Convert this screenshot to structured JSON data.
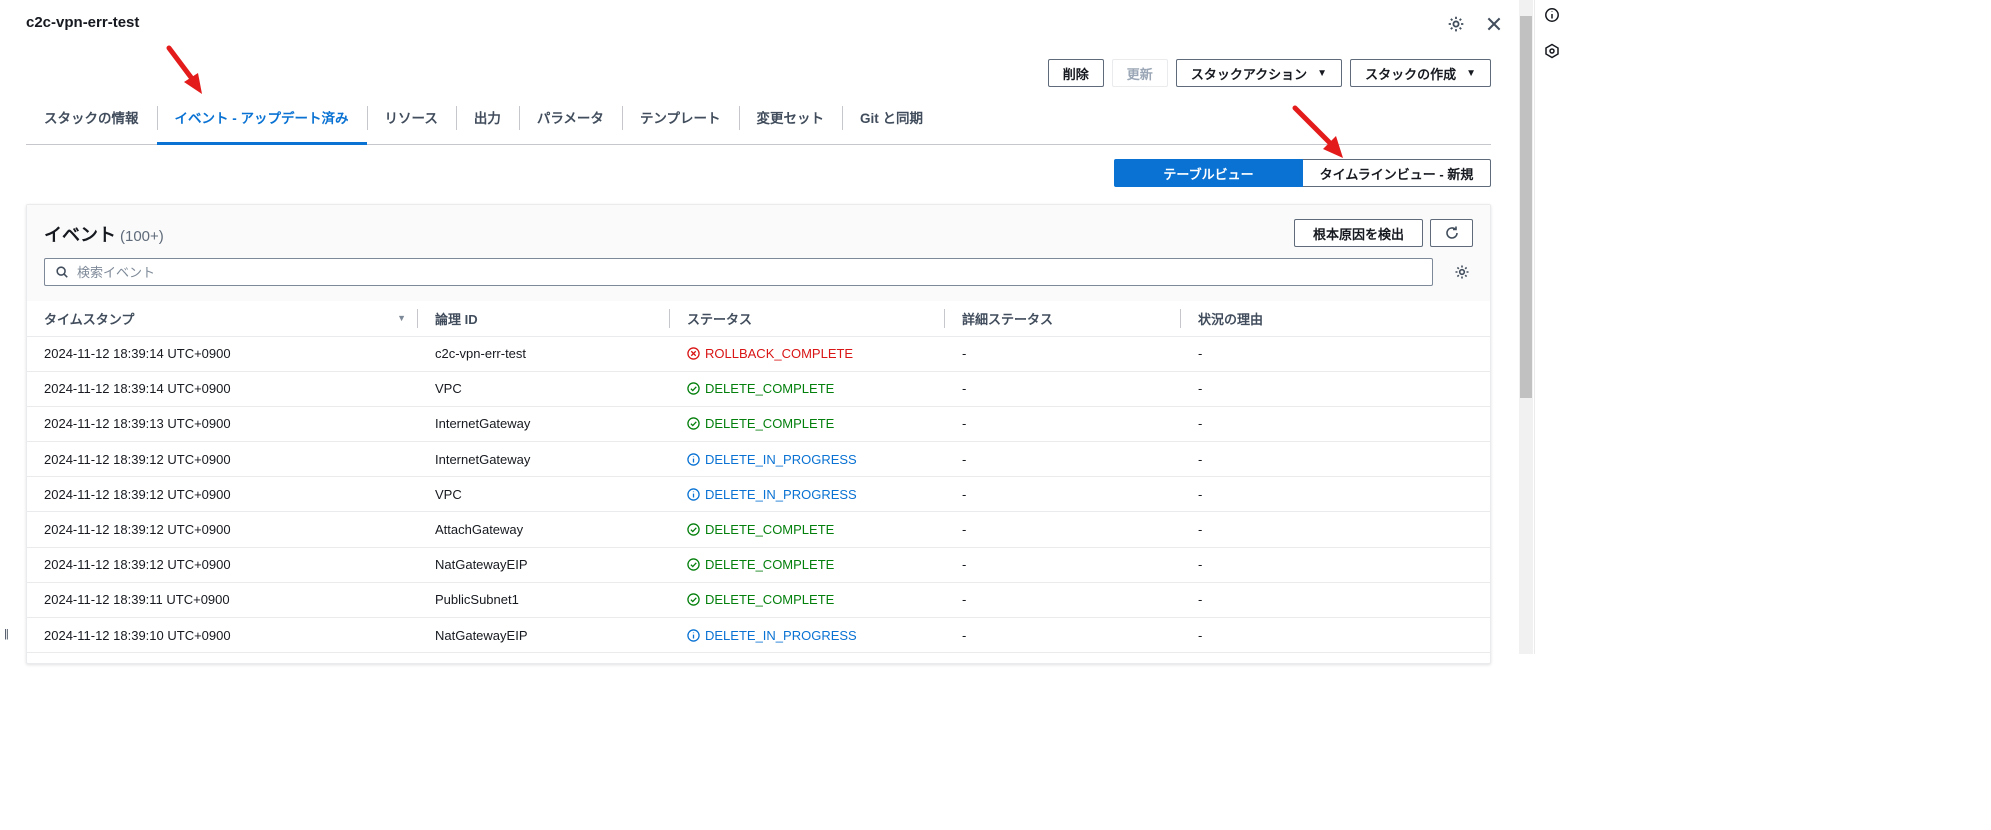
{
  "header": {
    "title": "c2c-vpn-err-test"
  },
  "actions": {
    "delete_label": "削除",
    "update_label": "更新",
    "stack_actions_label": "スタックアクション",
    "create_stack_label": "スタックの作成"
  },
  "tabs": [
    {
      "label": "スタックの情報"
    },
    {
      "label": "イベント - アップデート済み"
    },
    {
      "label": "リソース"
    },
    {
      "label": "出力"
    },
    {
      "label": "パラメータ"
    },
    {
      "label": "テンプレート"
    },
    {
      "label": "変更セット"
    },
    {
      "label": "Git と同期"
    }
  ],
  "active_tab": "イベント - アップデート済み",
  "view_toggle": {
    "table_view": "テーブルビュー",
    "timeline_view": "タイムラインビュー - 新規"
  },
  "events": {
    "title": "イベント",
    "count": "(100+)",
    "root_cause_label": "根本原因を検出",
    "search_placeholder": "検索イベント",
    "columns": [
      "タイムスタンプ",
      "論理 ID",
      "ステータス",
      "詳細ステータス",
      "状況の理由"
    ],
    "rows": [
      {
        "timestamp": "2024-11-12 18:39:14 UTC+0900",
        "logical_id": "c2c-vpn-err-test",
        "status": "ROLLBACK_COMPLETE",
        "status_kind": "error",
        "detail": "-",
        "reason": "-"
      },
      {
        "timestamp": "2024-11-12 18:39:14 UTC+0900",
        "logical_id": "VPC",
        "status": "DELETE_COMPLETE",
        "status_kind": "success",
        "detail": "-",
        "reason": "-"
      },
      {
        "timestamp": "2024-11-12 18:39:13 UTC+0900",
        "logical_id": "InternetGateway",
        "status": "DELETE_COMPLETE",
        "status_kind": "success",
        "detail": "-",
        "reason": "-"
      },
      {
        "timestamp": "2024-11-12 18:39:12 UTC+0900",
        "logical_id": "InternetGateway",
        "status": "DELETE_IN_PROGRESS",
        "status_kind": "info",
        "detail": "-",
        "reason": "-"
      },
      {
        "timestamp": "2024-11-12 18:39:12 UTC+0900",
        "logical_id": "VPC",
        "status": "DELETE_IN_PROGRESS",
        "status_kind": "info",
        "detail": "-",
        "reason": "-"
      },
      {
        "timestamp": "2024-11-12 18:39:12 UTC+0900",
        "logical_id": "AttachGateway",
        "status": "DELETE_COMPLETE",
        "status_kind": "success",
        "detail": "-",
        "reason": "-"
      },
      {
        "timestamp": "2024-11-12 18:39:12 UTC+0900",
        "logical_id": "NatGatewayEIP",
        "status": "DELETE_COMPLETE",
        "status_kind": "success",
        "detail": "-",
        "reason": "-"
      },
      {
        "timestamp": "2024-11-12 18:39:11 UTC+0900",
        "logical_id": "PublicSubnet1",
        "status": "DELETE_COMPLETE",
        "status_kind": "success",
        "detail": "-",
        "reason": "-"
      },
      {
        "timestamp": "2024-11-12 18:39:10 UTC+0900",
        "logical_id": "NatGatewayEIP",
        "status": "DELETE_IN_PROGRESS",
        "status_kind": "info",
        "detail": "-",
        "reason": "-"
      }
    ]
  },
  "colors": {
    "accent": "#0972d3",
    "error": "#d91515",
    "success": "#037f0c",
    "annotation_arrow": "#e31b1b"
  },
  "icons": [
    "settings-icon",
    "close-icon",
    "info-icon",
    "help-panel-icon",
    "search-icon",
    "refresh-icon",
    "sort-icon",
    "status-error-icon",
    "status-success-icon",
    "status-info-icon",
    "annotation-arrow-icon",
    "drag-handle-icon"
  ]
}
